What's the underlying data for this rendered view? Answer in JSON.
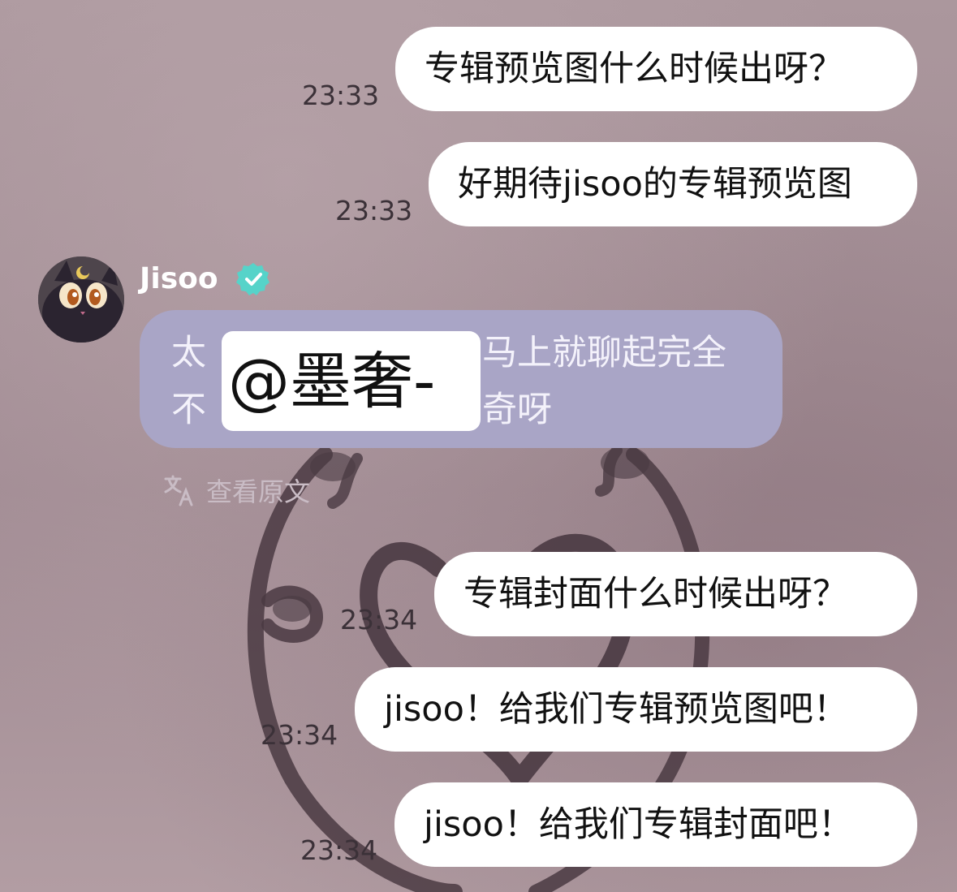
{
  "messages": [
    {
      "text": "专辑预览图什么时候出呀？",
      "time": "23:33"
    },
    {
      "text": "好期待jisoo的专辑预览图",
      "time": "23:33"
    },
    {
      "text": "专辑封面什么时候出呀？",
      "time": "23:34"
    },
    {
      "text": "jisoo！给我们专辑预览图吧！",
      "time": "23:34"
    },
    {
      "text": "jisoo！给我们专辑封面吧！",
      "time": "23:34"
    }
  ],
  "incoming": {
    "sender": "Jisoo",
    "line1_left": "太",
    "line1_right": "马上就聊起完全",
    "line2_left": "不",
    "line2_right": "奇呀",
    "verified_icon": "verified-check-icon",
    "avatar_icon": "black-cat-avatar"
  },
  "watermark": "@墨奢-",
  "translate": {
    "label": "查看原文",
    "icon": "translate-icon"
  },
  "colors": {
    "outgoing_bubble": "#ffffff",
    "incoming_bubble": "#a9a5c6",
    "verified": "#56d3c9"
  }
}
